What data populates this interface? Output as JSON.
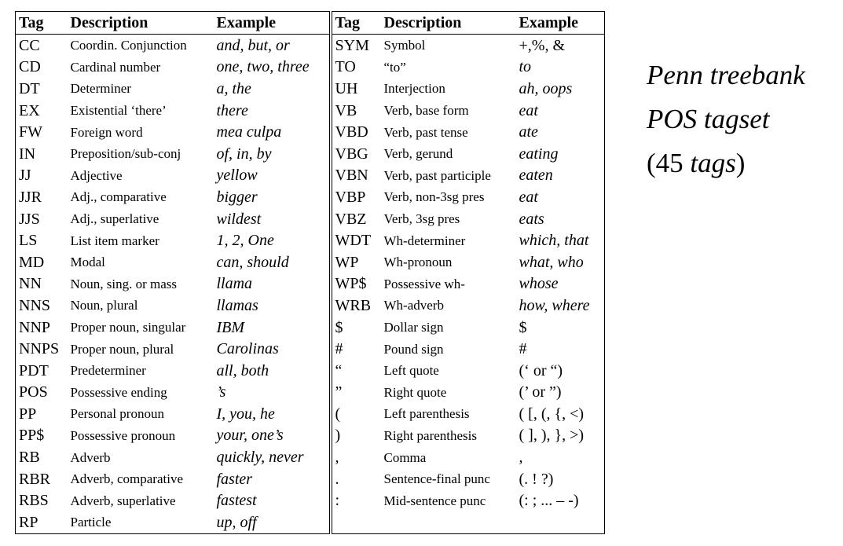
{
  "headers": [
    "Tag",
    "Description",
    "Example",
    "Tag",
    "Description",
    "Example"
  ],
  "left": [
    {
      "tag": "CC",
      "desc": "Coordin. Conjunction",
      "ex": "and, but, or"
    },
    {
      "tag": "CD",
      "desc": "Cardinal number",
      "ex": "one, two, three"
    },
    {
      "tag": "DT",
      "desc": "Determiner",
      "ex": "a, the"
    },
    {
      "tag": "EX",
      "desc": "Existential ‘there’",
      "ex": "there"
    },
    {
      "tag": "FW",
      "desc": "Foreign word",
      "ex": "mea culpa"
    },
    {
      "tag": "IN",
      "desc": "Preposition/sub-conj",
      "ex": "of, in, by"
    },
    {
      "tag": "JJ",
      "desc": "Adjective",
      "ex": "yellow"
    },
    {
      "tag": "JJR",
      "desc": "Adj., comparative",
      "ex": "bigger"
    },
    {
      "tag": "JJS",
      "desc": "Adj., superlative",
      "ex": "wildest"
    },
    {
      "tag": "LS",
      "desc": "List item marker",
      "ex": "1, 2, One"
    },
    {
      "tag": "MD",
      "desc": "Modal",
      "ex": "can, should"
    },
    {
      "tag": "NN",
      "desc": "Noun, sing. or mass",
      "ex": "llama"
    },
    {
      "tag": "NNS",
      "desc": "Noun, plural",
      "ex": "llamas"
    },
    {
      "tag": "NNP",
      "desc": "Proper noun, singular",
      "ex": "IBM"
    },
    {
      "tag": "NNPS",
      "desc": "Proper noun, plural",
      "ex": "Carolinas"
    },
    {
      "tag": "PDT",
      "desc": "Predeterminer",
      "ex": "all, both"
    },
    {
      "tag": "POS",
      "desc": "Possessive ending",
      "ex": "’s"
    },
    {
      "tag": "PP",
      "desc": "Personal pronoun",
      "ex": "I, you, he"
    },
    {
      "tag": "PP$",
      "desc": "Possessive pronoun",
      "ex": "your, one’s"
    },
    {
      "tag": "RB",
      "desc": "Adverb",
      "ex": "quickly, never"
    },
    {
      "tag": "RBR",
      "desc": "Adverb, comparative",
      "ex": "faster"
    },
    {
      "tag": "RBS",
      "desc": "Adverb, superlative",
      "ex": "fastest"
    },
    {
      "tag": "RP",
      "desc": "Particle",
      "ex": "up, off"
    }
  ],
  "right": [
    {
      "tag": "SYM",
      "desc": "Symbol",
      "ex": "+,%, &",
      "plain": true
    },
    {
      "tag": "TO",
      "desc": "“to”",
      "ex": "to"
    },
    {
      "tag": "UH",
      "desc": "Interjection",
      "ex": "ah, oops"
    },
    {
      "tag": "VB",
      "desc": "Verb, base form",
      "ex": "eat"
    },
    {
      "tag": "VBD",
      "desc": "Verb, past tense",
      "ex": "ate"
    },
    {
      "tag": "VBG",
      "desc": "Verb, gerund",
      "ex": "eating"
    },
    {
      "tag": "VBN",
      "desc": "Verb, past participle",
      "ex": "eaten"
    },
    {
      "tag": "VBP",
      "desc": "Verb, non-3sg pres",
      "ex": "eat"
    },
    {
      "tag": "VBZ",
      "desc": "Verb, 3sg pres",
      "ex": "eats"
    },
    {
      "tag": "WDT",
      "desc": "Wh-determiner",
      "ex": "which, that"
    },
    {
      "tag": "WP",
      "desc": "Wh-pronoun",
      "ex": "what, who"
    },
    {
      "tag": "WP$",
      "desc": "Possessive wh-",
      "ex": "whose"
    },
    {
      "tag": "WRB",
      "desc": "Wh-adverb",
      "ex": "how, where"
    },
    {
      "tag": "$",
      "desc": "Dollar sign",
      "ex": "$",
      "plain": true
    },
    {
      "tag": "#",
      "desc": "Pound sign",
      "ex": "#",
      "plain": true
    },
    {
      "tag": "“",
      "desc": "Left quote",
      "ex": "(‘ or “)",
      "plain": true
    },
    {
      "tag": "”",
      "desc": "Right quote",
      "ex": "(’ or ”)",
      "plain": true
    },
    {
      "tag": "(",
      "desc": "Left parenthesis",
      "ex": "( [, (, {, <)",
      "plain": true
    },
    {
      "tag": ")",
      "desc": "Right parenthesis",
      "ex": "( ], ), }, >)",
      "plain": true
    },
    {
      "tag": ",",
      "desc": "Comma",
      "ex": ",",
      "plain": true
    },
    {
      "tag": ".",
      "desc": "Sentence-final punc",
      "ex": "(. ! ?)",
      "plain": true
    },
    {
      "tag": ":",
      "desc": "Mid-sentence punc",
      "ex": "(: ; ... – -)",
      "plain": true
    },
    {
      "tag": "",
      "desc": "",
      "ex": ""
    }
  ],
  "caption": {
    "line1": "Penn treebank",
    "line2": "POS tagset",
    "line3_open": "(45 ",
    "line3_italic": "tags",
    "line3_close": ")"
  }
}
